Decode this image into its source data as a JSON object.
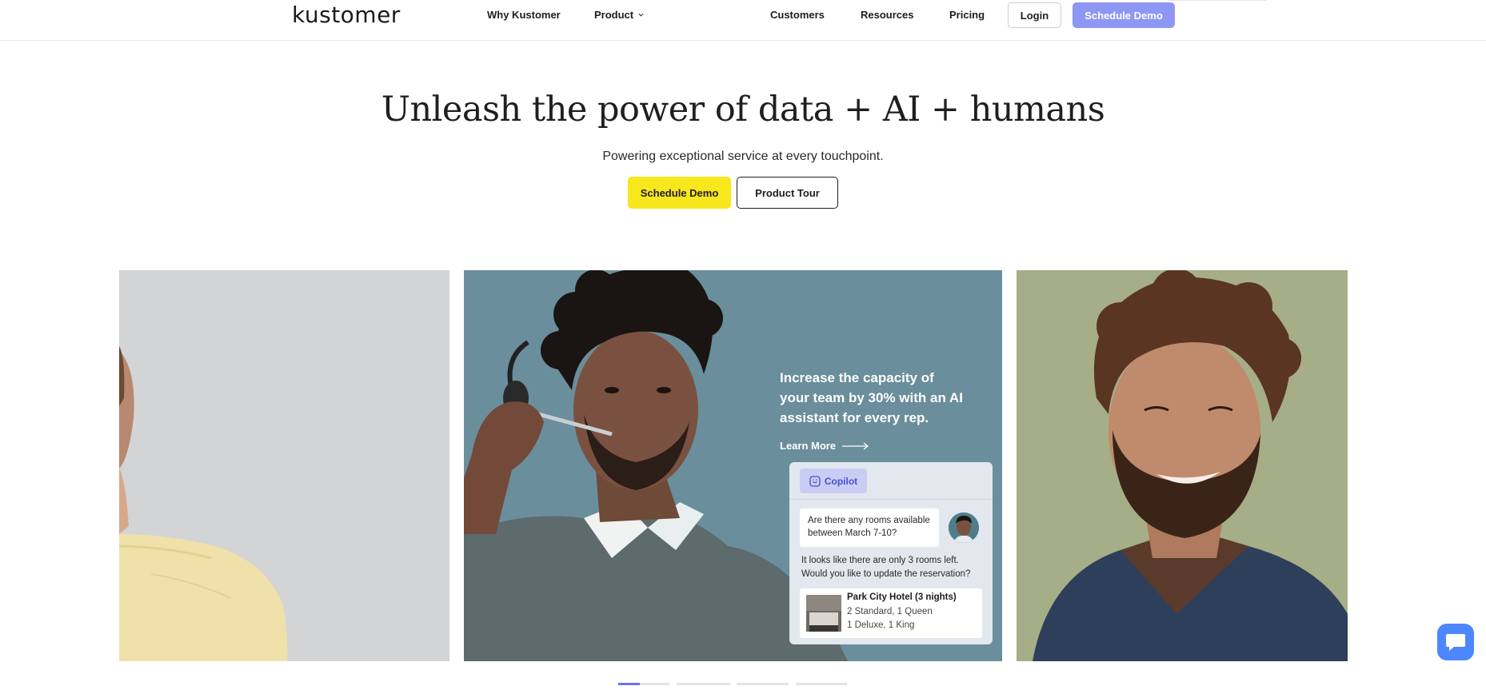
{
  "header": {
    "logo": "kustomer",
    "nav": [
      {
        "label": "Why Kustomer"
      },
      {
        "label": "Product"
      },
      {
        "label": "Customers"
      },
      {
        "label": "Resources"
      },
      {
        "label": "Pricing"
      }
    ],
    "login_label": "Login",
    "demo_label": "Schedule Demo"
  },
  "hero": {
    "title": "Unleash the power of data + AI + humans",
    "subtitle": "Powering exceptional service at every touchpoint.",
    "primary_cta": "Schedule Demo",
    "secondary_cta": "Product Tour"
  },
  "carousel": {
    "active_slide": {
      "headline": "Increase the capacity of your team by 30% with an AI assistant for every rep.",
      "learn_more": "Learn More",
      "copilot": {
        "tag": "Copilot",
        "question": "Are there any rooms available between March 7-10?",
        "answer": "It looks like there are only 3 rooms left. Would you like to update the reservation?",
        "hotel": {
          "name": "Park City Hotel (3 nights)",
          "line1": "2 Standard, 1 Queen",
          "line2": "1 Deluxe, 1 King"
        }
      }
    },
    "pager": {
      "count": 4,
      "active_index": 0,
      "active_progress": 0.42
    }
  },
  "colors": {
    "accent_yellow": "#f8e71c",
    "nav_demo": "#8e97f3",
    "pager_active": "#6e73e8",
    "chat_widget": "#4c87ff"
  },
  "icons": [
    "chevron-down-icon",
    "arrow-right-icon",
    "copilot-icon",
    "chat-icon"
  ]
}
